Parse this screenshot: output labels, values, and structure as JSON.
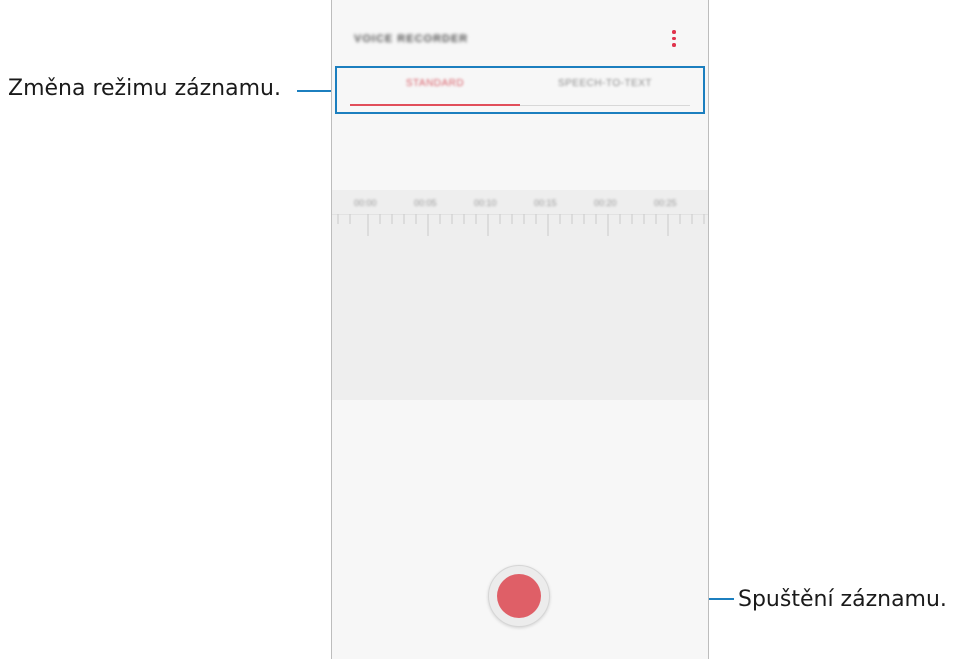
{
  "callouts": {
    "mode": "Změna režimu záznamu.",
    "record": "Spuštění záznamu."
  },
  "app": {
    "title": "VOICE RECORDER",
    "tabs": [
      {
        "label": "STANDARD",
        "selected": true
      },
      {
        "label": "SPEECH-TO-TEXT",
        "selected": false
      }
    ],
    "timeline_labels": [
      "00:00",
      "00:05",
      "00:10",
      "00:15",
      "00:20",
      "00:25"
    ]
  },
  "colors": {
    "accent": "#e14f5b",
    "callout_line": "#1c7fbf"
  },
  "icons": {
    "more": "more-vertical-icon",
    "record": "record-icon"
  }
}
